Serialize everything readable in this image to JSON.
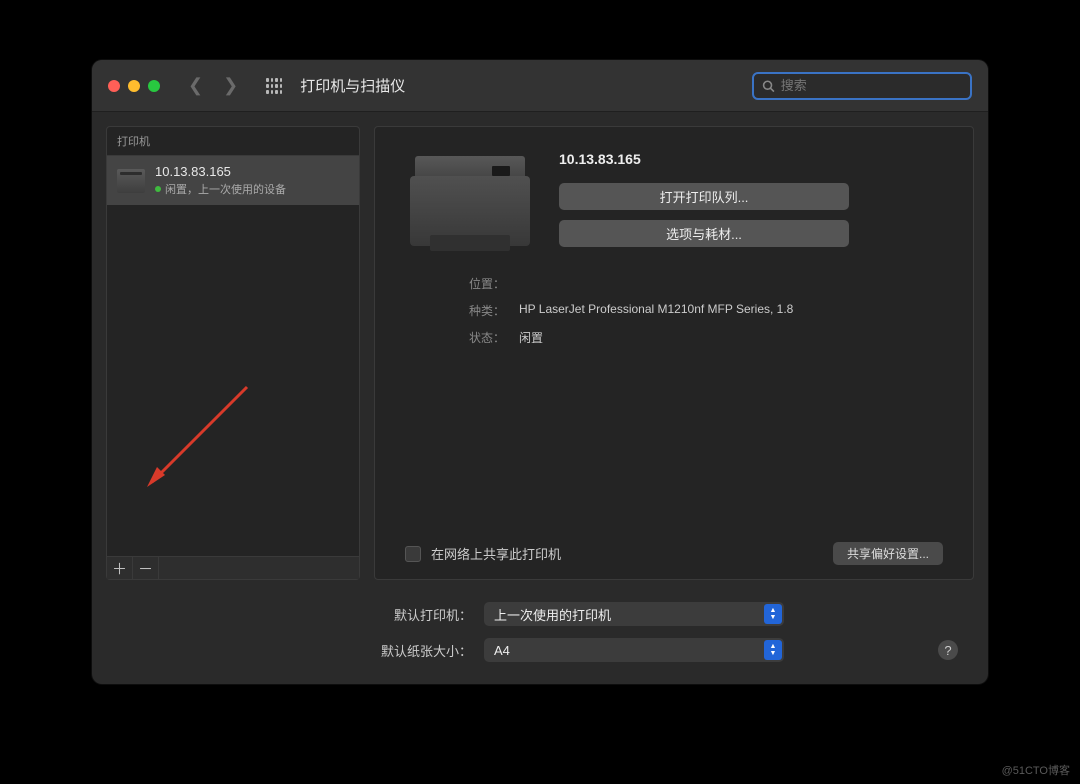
{
  "titlebar": {
    "title": "打印机与扫描仪",
    "search_placeholder": "搜索"
  },
  "sidebar": {
    "header": "打印机",
    "printer": {
      "name": "10.13.83.165",
      "status": "闲置，上一次使用的设备"
    },
    "add": "＋",
    "remove": "－"
  },
  "detail": {
    "name": "10.13.83.165",
    "open_queue": "打开打印队列...",
    "options": "选项与耗材...",
    "meta": {
      "location_label": "位置：",
      "location_value": "",
      "kind_label": "种类：",
      "kind_value": "HP LaserJet Professional M1210nf MFP Series, 1.8",
      "status_label": "状态：",
      "status_value": "闲置"
    },
    "share_label": "在网络上共享此打印机",
    "share_prefs": "共享偏好设置..."
  },
  "bottom": {
    "default_printer_label": "默认打印机：",
    "default_printer_value": "上一次使用的打印机",
    "default_paper_label": "默认纸张大小：",
    "default_paper_value": "A4",
    "help": "?"
  },
  "watermark": "@51CTO博客"
}
